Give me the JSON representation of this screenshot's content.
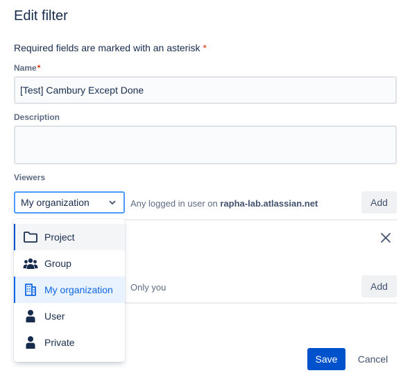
{
  "dialog": {
    "title": "Edit filter",
    "required_note": "Required fields are marked with an asterisk",
    "asterisk": "*"
  },
  "name_field": {
    "label": "Name",
    "value": "[Test] Cambury Except Done"
  },
  "description_field": {
    "label": "Description",
    "value": ""
  },
  "viewers": {
    "label": "Viewers",
    "selected": "My organization",
    "hint_prefix": "Any logged in user on ",
    "hint_domain": "rapha-lab.atlassian.net",
    "add_label": "Add"
  },
  "viewers_dropdown": {
    "items": [
      {
        "label": "Project",
        "icon": "folder-icon"
      },
      {
        "label": "Group",
        "icon": "people-group-icon"
      },
      {
        "label": "My organization",
        "icon": "office-building-icon"
      },
      {
        "label": "User",
        "icon": "person-icon"
      },
      {
        "label": "Private",
        "icon": "person-icon"
      }
    ]
  },
  "editors": {
    "hint": "Only you",
    "add_label": "Add"
  },
  "footer": {
    "save_label": "Save",
    "cancel_label": "Cancel"
  },
  "colors": {
    "primary": "#0052cc",
    "selected_text": "#0c66e4",
    "selected_bg": "#e9f2ff",
    "required": "#de350b",
    "focus_border": "#4c9aff"
  }
}
